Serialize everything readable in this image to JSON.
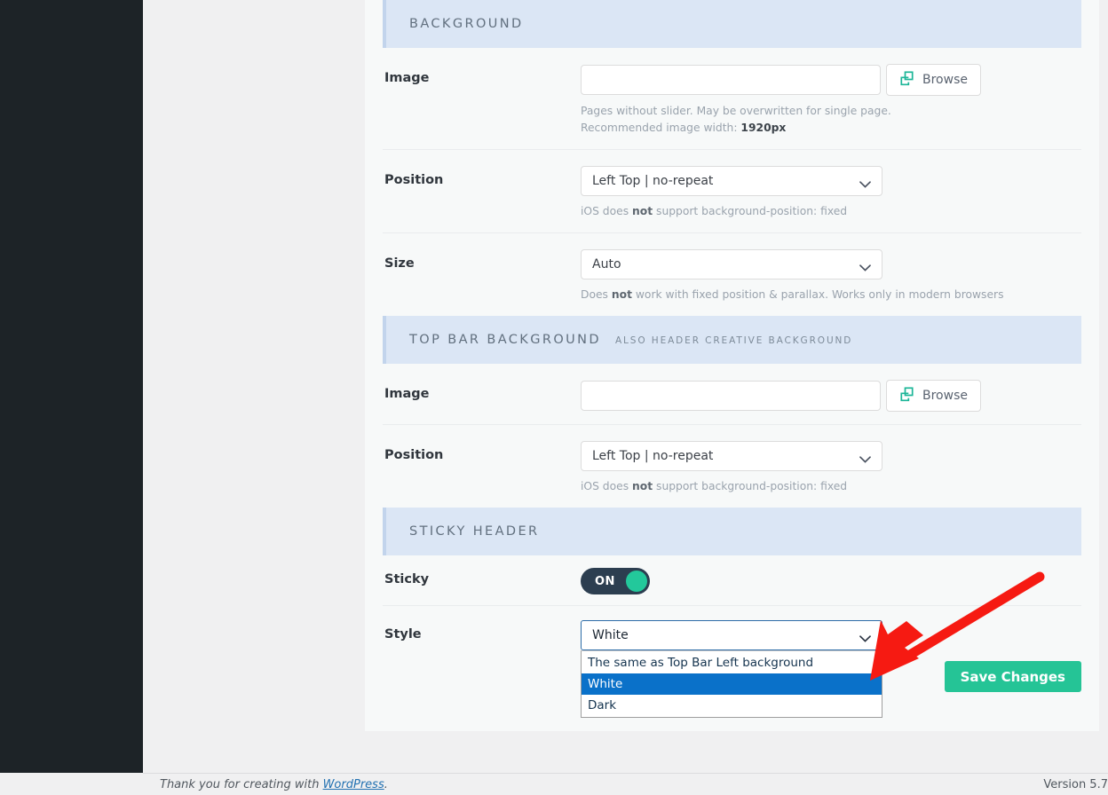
{
  "panel": {
    "sections": [
      {
        "id": "background",
        "title": "BACKGROUND",
        "subtitle": "",
        "fields": [
          {
            "id": "bg-image",
            "label": "Image",
            "type": "file",
            "value": "",
            "placeholder": "",
            "button_label": "Browse",
            "button_icon": "browse-copy-icon",
            "hint_line1_pre": "Pages without slider. May be overwritten for single page.",
            "hint_line2_pre": "Recommended image width: ",
            "hint_line2_strong": "1920px"
          },
          {
            "id": "bg-position",
            "label": "Position",
            "type": "select",
            "value": "Left Top | no-repeat",
            "hint_pre": "iOS does ",
            "hint_strong": "not",
            "hint_post": " support background-position: fixed"
          },
          {
            "id": "bg-size",
            "label": "Size",
            "type": "select",
            "value": "Auto",
            "hint_pre": "Does ",
            "hint_strong": "not",
            "hint_post": " work with fixed position & parallax. Works only in modern browsers"
          }
        ]
      },
      {
        "id": "top-bar-background",
        "title": "TOP BAR BACKGROUND",
        "subtitle": "ALSO HEADER CREATIVE BACKGROUND",
        "fields": [
          {
            "id": "topbar-image",
            "label": "Image",
            "type": "file",
            "value": "",
            "placeholder": "",
            "button_label": "Browse",
            "button_icon": "browse-copy-icon"
          },
          {
            "id": "topbar-position",
            "label": "Position",
            "type": "select",
            "value": "Left Top | no-repeat",
            "hint_pre": "iOS does ",
            "hint_strong": "not",
            "hint_post": " support background-position: fixed"
          }
        ]
      },
      {
        "id": "sticky-header",
        "title": "STICKY HEADER",
        "subtitle": "",
        "fields": [
          {
            "id": "sticky-toggle",
            "label": "Sticky",
            "type": "toggle",
            "state_label": "ON",
            "state": "on"
          },
          {
            "id": "sticky-style",
            "label": "Style",
            "type": "select-open",
            "value": "White",
            "options": [
              "The same as Top Bar Left background",
              "White",
              "Dark"
            ],
            "selected_index": 1
          }
        ]
      }
    ],
    "save_label": "Save Changes"
  },
  "footer": {
    "thanks_pre": "Thank you for creating with ",
    "thanks_link": "WordPress",
    "thanks_post": ".",
    "version": "Version 5.7"
  },
  "colors": {
    "section_header_bg": "#dbe6f5",
    "section_header_accent": "#c2d4ec",
    "toggle_on_bg": "#2c3e50",
    "toggle_knob": "#23c89b",
    "save_button": "#25c496",
    "dropdown_highlight": "#0a71c9",
    "arrow": "#f61a12",
    "sidebar": "#1d2327",
    "browse_icon": "#1cb698"
  }
}
